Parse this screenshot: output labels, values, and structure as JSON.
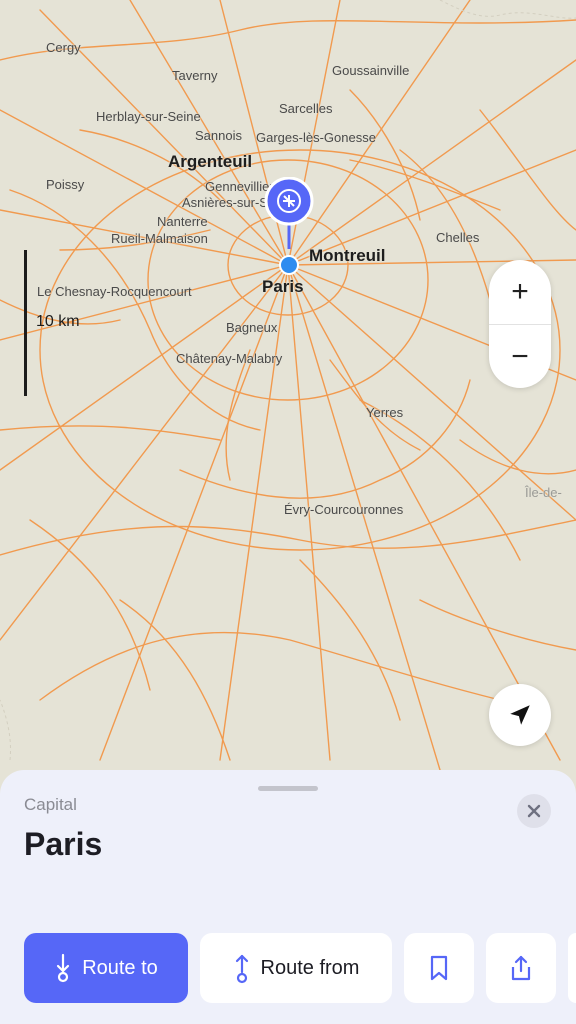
{
  "map": {
    "places": [
      {
        "label": "Cergy"
      },
      {
        "label": "Taverny"
      },
      {
        "label": "Goussainville"
      },
      {
        "label": "Herblay-sur-Seine"
      },
      {
        "label": "Sarcelles"
      },
      {
        "label": "Sannois"
      },
      {
        "label": "Garges-lès-Gonesse"
      },
      {
        "label": "Argenteuil"
      },
      {
        "label": "Poissy"
      },
      {
        "label": "Gennevilliers"
      },
      {
        "label": "Asnières-sur-Seine"
      },
      {
        "label": "Nanterre"
      },
      {
        "label": "Rueil-Malmaison"
      },
      {
        "label": "Montreuil"
      },
      {
        "label": "Chelles"
      },
      {
        "label": "Paris"
      },
      {
        "label": "Le Chesnay-Rocquencourt"
      },
      {
        "label": "Bagneux"
      },
      {
        "label": "Châtenay-Malabry"
      },
      {
        "label": "Yerres"
      },
      {
        "label": "Île-de-"
      },
      {
        "label": "Évry-Courcouronnes"
      }
    ],
    "scale_label": "10 km",
    "zoom_in_symbol": "+",
    "zoom_out_symbol": "−",
    "road_color": "#f19a4f",
    "background_color": "#e5e3d6",
    "pin_color": "#5667f7"
  },
  "sheet": {
    "subtitle": "Capital",
    "title": "Paris",
    "close_icon": "close-icon",
    "buttons": {
      "route_to": "Route to",
      "route_from": "Route from",
      "bookmark_icon": "bookmark-icon",
      "share_icon": "share-icon"
    },
    "accent_color": "#5667f7"
  }
}
